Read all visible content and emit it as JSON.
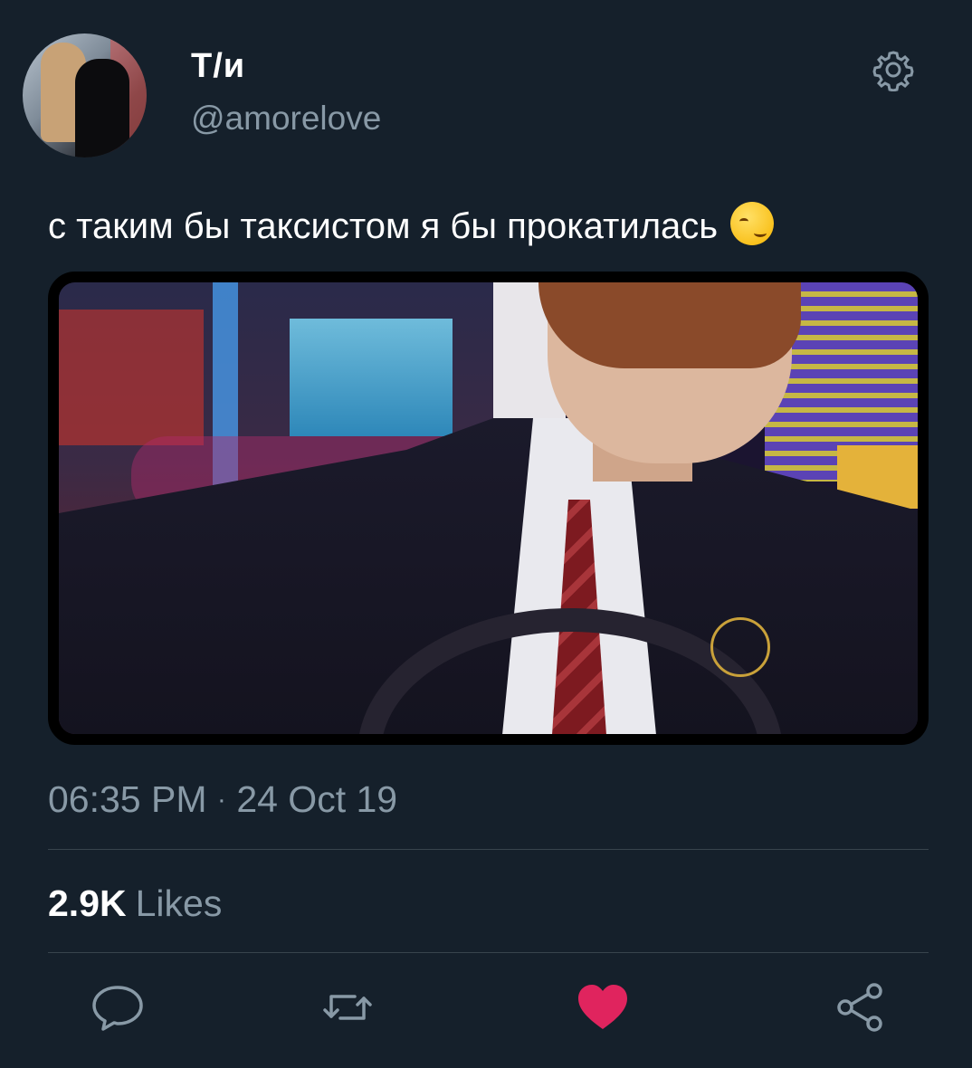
{
  "author": {
    "display_name": "Т/и",
    "handle": "@amorelove"
  },
  "tweet": {
    "text": "с таким бы таксистом я бы прокатилась",
    "emoji": "smirking-face"
  },
  "meta": {
    "time": "06:35 PM",
    "separator": "·",
    "date": "24 Oct 19"
  },
  "stats": {
    "likes_count": "2.9K",
    "likes_label": "Likes"
  },
  "actions": [
    {
      "name": "reply",
      "icon": "speech-bubble-icon"
    },
    {
      "name": "retweet",
      "icon": "retweet-icon"
    },
    {
      "name": "like",
      "icon": "heart-icon",
      "active": true,
      "color": "#e0245e"
    },
    {
      "name": "share",
      "icon": "share-icon"
    }
  ],
  "colors": {
    "background": "#15202b",
    "secondary_text": "#8899a6",
    "divider": "#38444d",
    "like_active": "#e0245e"
  }
}
